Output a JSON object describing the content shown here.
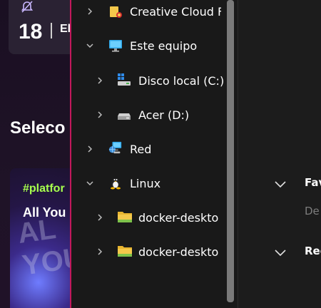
{
  "background_app": {
    "date_day": "18",
    "date_month": "El",
    "heading": "Seleco",
    "card_tag": "#platfor",
    "card_title": "All You",
    "card_art_text": "AL YOU"
  },
  "nav": {
    "items": [
      {
        "label": "Creative Cloud F",
        "icon": "creative-cloud-folder-icon",
        "expanded": false
      },
      {
        "label": "Este equipo",
        "icon": "this-pc-monitor-icon",
        "expanded": true
      },
      {
        "label": "Disco local (C:)",
        "icon": "windows-drive-icon",
        "expanded": false
      },
      {
        "label": "Acer (D:)",
        "icon": "drive-icon",
        "expanded": false
      },
      {
        "label": "Red",
        "icon": "network-icon",
        "expanded": false
      },
      {
        "label": "Linux",
        "icon": "linux-penguin-icon",
        "expanded": true
      },
      {
        "label": "docker-deskto",
        "icon": "folder-icon",
        "expanded": false
      },
      {
        "label": "docker-deskto",
        "icon": "folder-icon",
        "expanded": false
      }
    ]
  },
  "right_pane": {
    "favorites_label": "Fav",
    "favorites_desc": "De",
    "recent_label": "Rec"
  },
  "colors": {
    "accent_border": "#c2185b",
    "folder_yellow": "#f4c84b",
    "tag_green": "#a6ff4d"
  }
}
